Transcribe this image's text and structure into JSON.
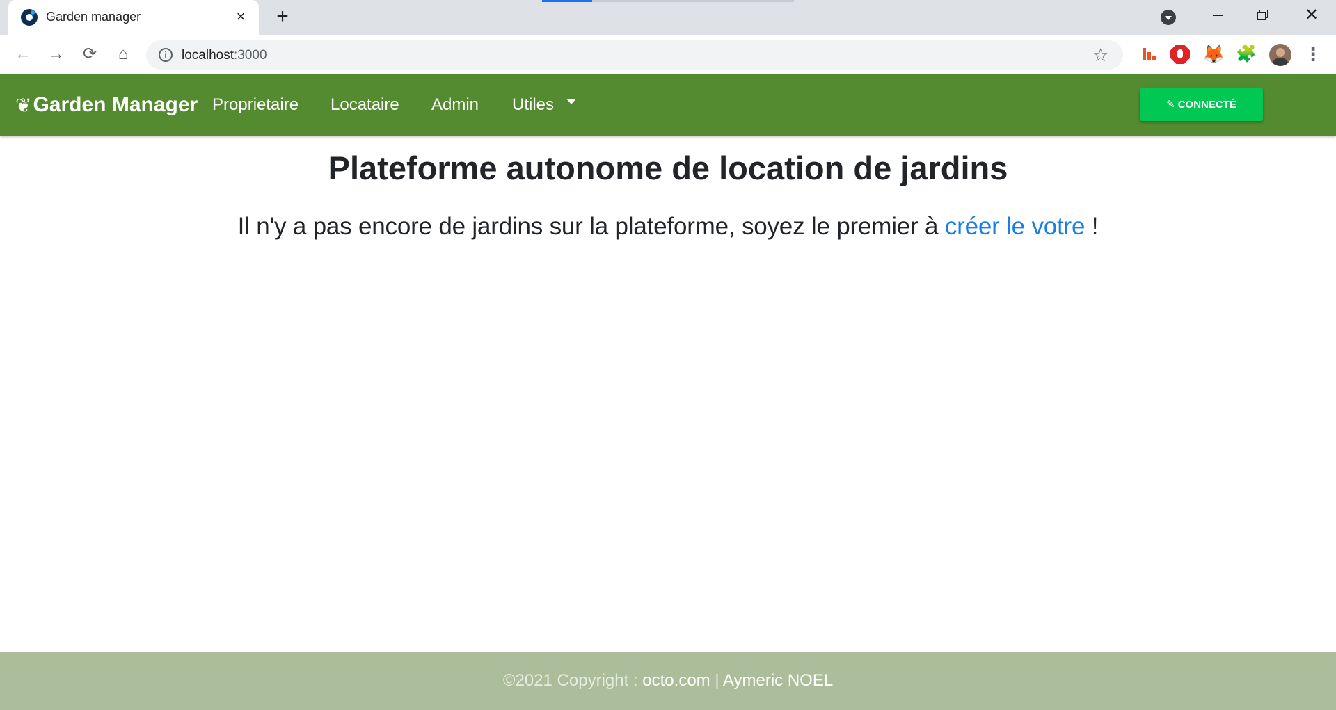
{
  "browser": {
    "tab_title": "Garden manager",
    "url_host": "localhost",
    "url_port": ":3000",
    "icons": {
      "favicon": "garden-favicon",
      "close": "×",
      "new_tab": "+",
      "back": "←",
      "forward": "→",
      "reload": "⟳",
      "home": "⌂",
      "info": "i",
      "star": "☆",
      "extension_fox": "🦊",
      "puzzle": "🧩",
      "menu": "⋮",
      "window_close": "✕"
    }
  },
  "navbar": {
    "brand": "Garden Manager",
    "brand_icon": "❦",
    "links": [
      "Proprietaire",
      "Locataire",
      "Admin",
      "Utiles"
    ],
    "connect_label": "CONNECTÉ",
    "connect_icon": "✎",
    "bg_color": "#548b30",
    "button_color": "#00c853"
  },
  "main": {
    "title": "Plateforme autonome de location de jardins",
    "lead_prefix": "Il n'y a pas encore de jardins sur la plateforme, soyez le premier à ",
    "lead_link": "créer le votre",
    "lead_suffix": " !",
    "link_color": "#1a7fe0"
  },
  "footer": {
    "copyright": "©2021 Copyright : ",
    "site": "octo.com",
    "separator": " | ",
    "author": "Aymeric NOEL",
    "bg_color": "#abbd9a"
  }
}
